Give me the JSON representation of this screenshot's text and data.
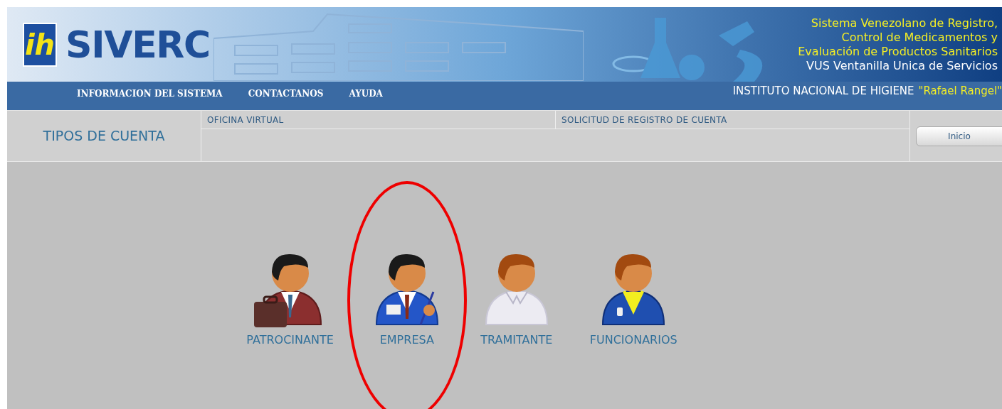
{
  "logo": {
    "badge": "ih",
    "name": "SIVERC"
  },
  "banner": {
    "title_lines": [
      "Sistema Venezolano de Registro,",
      "Control de Medicamentos y",
      "Evaluación de Productos Sanitarios"
    ],
    "subtitle": "VUS Ventanilla Unica de Servicios"
  },
  "nav": {
    "items": [
      "INFORMACION DEL SISTEMA",
      "CONTACTANOS",
      "AYUDA"
    ],
    "institute": "INSTITUTO NACIONAL DE HIGIENE",
    "institute_name": "\"Rafael Rangel\""
  },
  "section": {
    "title": "TIPOS DE CUENTA",
    "breadcrumbs": [
      "OFICINA VIRTUAL",
      "SOLICITUD DE REGISTRO DE CUENTA"
    ],
    "home_button": "Inicio"
  },
  "account_types": [
    {
      "label": "PATROCINANTE",
      "kind": "briefcase",
      "circled": false
    },
    {
      "label": "EMPRESA",
      "kind": "badge",
      "circled": true
    },
    {
      "label": "TRAMITANTE",
      "kind": "shirt",
      "circled": false
    },
    {
      "label": "FUNCIONARIOS",
      "kind": "uniform",
      "circled": false
    }
  ]
}
